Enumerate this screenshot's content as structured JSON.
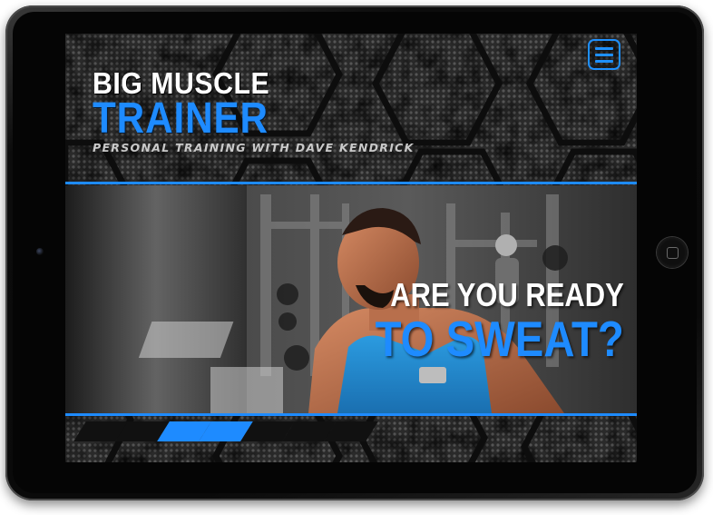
{
  "brand": {
    "line1": "BIG MUSCLE",
    "line2": "TRAINER",
    "tagline": "PERSONAL TRAINING WITH DAVE KENDRICK"
  },
  "menu": {
    "icon": "hamburger-menu-icon"
  },
  "hero": {
    "headline_line1": "ARE YOU READY",
    "headline_line2": "TO SWEAT?"
  },
  "slider": {
    "slide_count": 7,
    "active_slides": [
      3,
      4
    ]
  },
  "colors": {
    "accent": "#1e8bff",
    "inactive_slide": "#111111",
    "background": "#151515"
  }
}
